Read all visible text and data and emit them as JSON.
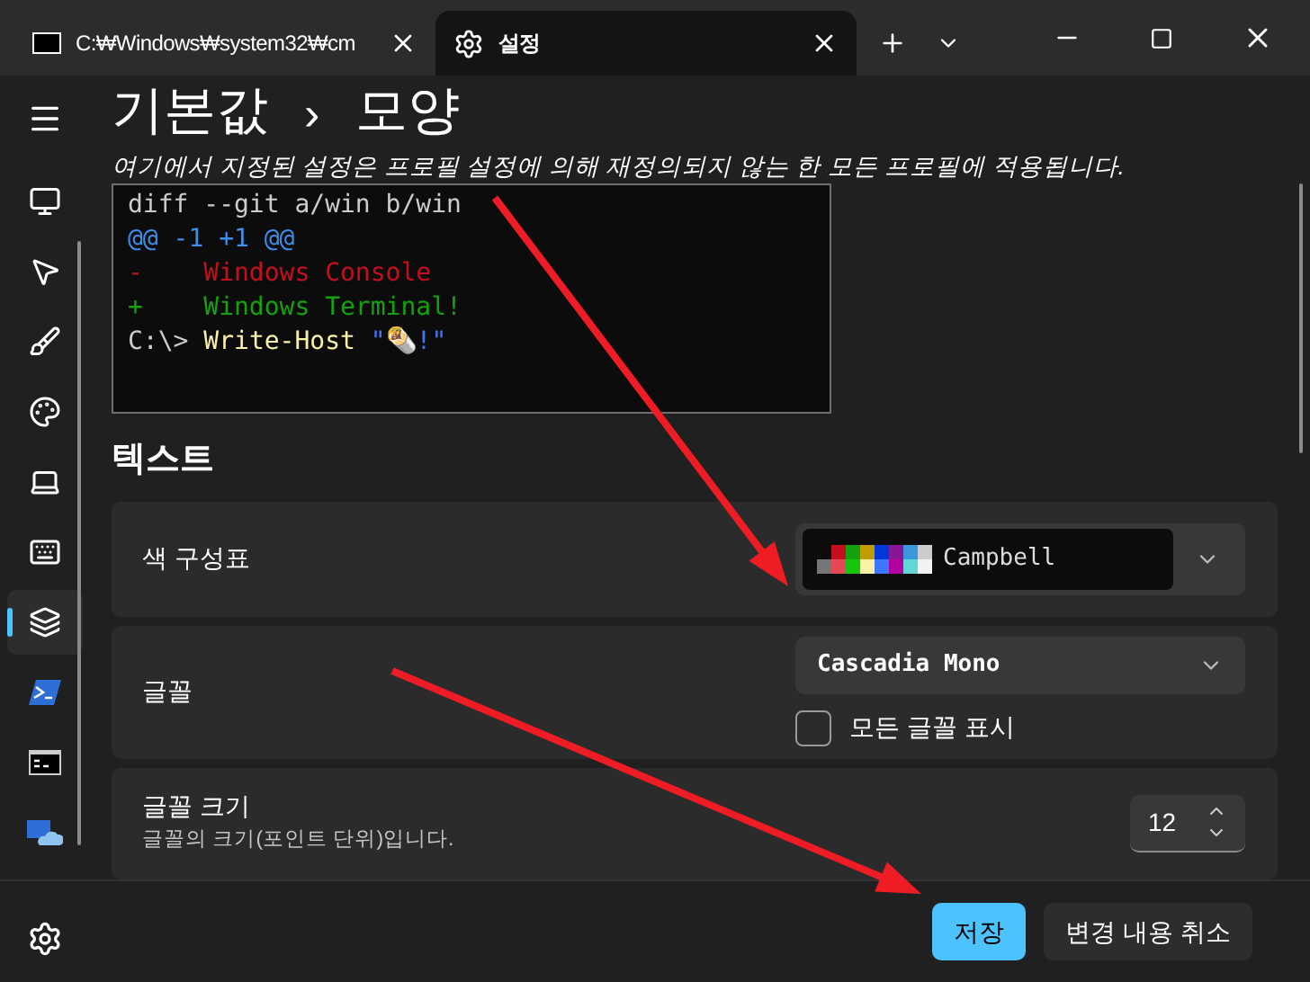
{
  "tabs": [
    {
      "kind": "terminal",
      "label": "C:₩Windows₩system32₩cm",
      "selected": false
    },
    {
      "kind": "settings",
      "label": "설정",
      "selected": true
    }
  ],
  "breadcrumb": [
    "기본값",
    "모양"
  ],
  "breadcrumb_separator": "›",
  "subtitle": "여기에서 지정된 설정은 프로필 설정에 의해 재정의되지 않는 한 모든 프로필에 적용됩니다.",
  "sidebar": {
    "items": [
      {
        "kind": "startup",
        "selected": false
      },
      {
        "kind": "interaction",
        "selected": false
      },
      {
        "kind": "appearance",
        "selected": false
      },
      {
        "kind": "color-schemes",
        "selected": false
      },
      {
        "kind": "rendering",
        "selected": false
      },
      {
        "kind": "actions",
        "selected": false
      },
      {
        "kind": "defaults",
        "selected": true
      },
      {
        "kind": "powershell",
        "selected": false
      },
      {
        "kind": "cmd",
        "selected": false
      },
      {
        "kind": "azure",
        "selected": false
      }
    ]
  },
  "preview": {
    "lines": [
      [
        {
          "text": "diff --git a/win b/win",
          "color": "#cccccc"
        }
      ],
      [
        {
          "text": "@@ -1 +1 @@",
          "color": "#3b8eea"
        }
      ],
      [
        {
          "text": "-    Windows Console",
          "color": "#c50f1f"
        }
      ],
      [
        {
          "text": "+    Windows Terminal!",
          "color": "#13a10e"
        }
      ],
      [
        {
          "text": "C:\\> ",
          "color": "#cccccc"
        },
        {
          "text": "Write-Host ",
          "color": "#f9f1a5"
        },
        {
          "text": "\"🌯!\"",
          "color": "#3b78ff"
        }
      ]
    ]
  },
  "section_title": "텍스트",
  "color_scheme": {
    "label": "색 구성표",
    "value": "Campbell"
  },
  "font_face": {
    "label": "글꼴",
    "value": "Cascadia Mono",
    "checkbox": {
      "label": "모든 글꼴 표시",
      "checked": false
    }
  },
  "font_size": {
    "label": "글꼴 크기",
    "description": "글꼴의 크기(포인트 단위)입니다.",
    "value": "12"
  },
  "buttons": [
    {
      "label": "저장",
      "kind": "primary"
    },
    {
      "label": "변경 내용 취소",
      "kind": "secondary"
    }
  ]
}
